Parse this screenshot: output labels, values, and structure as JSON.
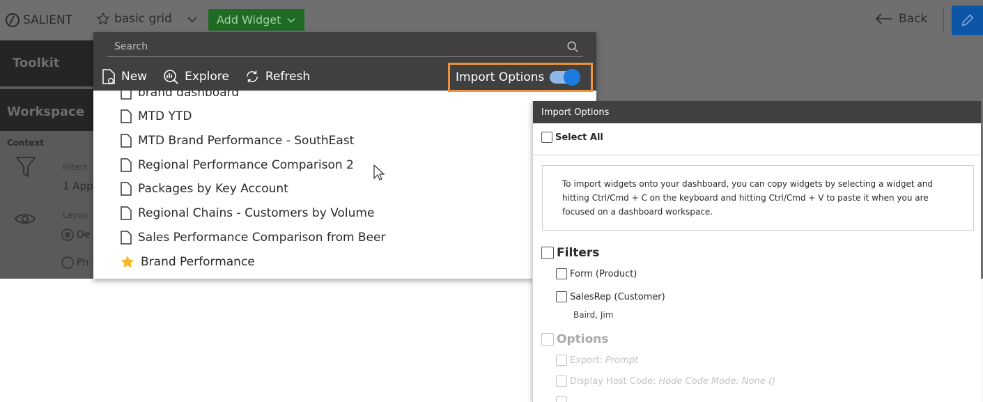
{
  "topbar": {
    "brand": "SALIENT",
    "dashboard_name": "basic grid",
    "add_widget_label": "Add Widget",
    "back_label": "Back"
  },
  "sidebar": {
    "toolkit_label": "Toolkit",
    "workspace_label": "Workspace",
    "context_label": "Context",
    "filters_label": "Filters",
    "filters_value": "1 App",
    "layout_label": "Layou",
    "radio1_label": "De",
    "radio2_label": "Ph"
  },
  "dropdown": {
    "search_placeholder": "Search",
    "actions": {
      "new_label": "New",
      "explore_label": "Explore",
      "refresh_label": "Refresh"
    },
    "import_options_label": "Import Options",
    "import_options_enabled": true,
    "items": [
      {
        "label": "brand dashboard",
        "icon": "document-icon"
      },
      {
        "label": "MTD YTD",
        "icon": "document-icon"
      },
      {
        "label": "MTD Brand Performance - SouthEast",
        "icon": "document-icon"
      },
      {
        "label": "Regional Performance Comparison 2",
        "icon": "document-icon"
      },
      {
        "label": "Packages by Key Account",
        "icon": "document-icon"
      },
      {
        "label": "Regional Chains - Customers by Volume",
        "icon": "document-icon"
      },
      {
        "label": "Sales Performance Comparison from Beer",
        "icon": "document-icon"
      },
      {
        "label": "Brand Performance",
        "icon": "star-icon"
      }
    ]
  },
  "import_panel": {
    "title": "Import Options",
    "select_all_label": "Select All",
    "info_text": "To import widgets onto your dashboard, you can copy widgets by selecting a widget and hitting Ctrl/Cmd + C on the keyboard and hitting Ctrl/Cmd + V to paste it when you are focused on a dashboard workspace.",
    "filters_label": "Filters",
    "filter_items": [
      {
        "label": "Form (Product)"
      },
      {
        "label": "SalesRep (Customer)",
        "sub": "Baird, Jim"
      }
    ],
    "options_label": "Options",
    "option_items": [
      {
        "label": "Export:",
        "value": "Prompt"
      },
      {
        "label": "Display Host Code:",
        "value": "Hode Code Mode: None ()"
      }
    ]
  },
  "colors": {
    "topbar_bg": "#6f6f6f",
    "dropdown_header_bg": "#404040",
    "add_widget_bg": "#1f6a25",
    "highlight_border": "#f2903b",
    "toggle_on": "#1c7bdc",
    "edit_button_bg": "#0d55a6"
  }
}
